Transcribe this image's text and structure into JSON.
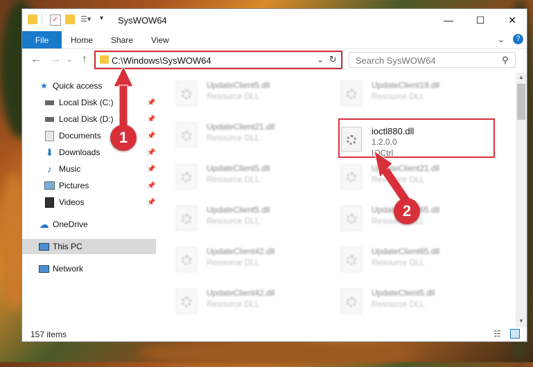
{
  "window": {
    "title": "SysWOW64"
  },
  "ribbon": {
    "tabs": [
      "File",
      "Home",
      "Share",
      "View"
    ]
  },
  "address": {
    "path": "C:\\Windows\\SysWOW64"
  },
  "search": {
    "placeholder": "Search SysWOW64"
  },
  "sidebar": {
    "items": [
      {
        "label": "Quick access",
        "icon": "star-icon"
      },
      {
        "label": "Local Disk (C:)",
        "icon": "drive-icon"
      },
      {
        "label": "Local Disk (D:)",
        "icon": "drive-icon"
      },
      {
        "label": "Documents",
        "icon": "documents-icon"
      },
      {
        "label": "Downloads",
        "icon": "download-icon"
      },
      {
        "label": "Music",
        "icon": "music-icon"
      },
      {
        "label": "Pictures",
        "icon": "pictures-icon"
      },
      {
        "label": "Videos",
        "icon": "videos-icon"
      },
      {
        "label": "OneDrive",
        "icon": "cloud-icon"
      },
      {
        "label": "This PC",
        "icon": "computer-icon"
      },
      {
        "label": "Network",
        "icon": "network-icon"
      }
    ]
  },
  "files": {
    "left": [
      {
        "name": "UpdateClient5.dll",
        "type": "Resource DLL"
      },
      {
        "name": "UpdateClient21.dll",
        "type": "Resource DLL"
      },
      {
        "name": "UpdateClient5.dll",
        "type": "Resource DLL"
      },
      {
        "name": "UpdateClient5.dll",
        "type": "Resource DLL"
      },
      {
        "name": "UpdateClient42.dll",
        "type": "Resource DLL"
      },
      {
        "name": "UpdateClient42.dll",
        "type": "Resource DLL"
      }
    ],
    "right": [
      {
        "name": "UpdateClient19.dll",
        "type": "Resource DLL"
      },
      {
        "name": "UpdateClient21.dll",
        "type": "Resource DLL"
      },
      {
        "name": "UpdateClient65.dll",
        "type": "Resource DLL"
      },
      {
        "name": "UpdateClient65.dll",
        "type": "Resource DLL"
      },
      {
        "name": "UpdateClient5.dll",
        "type": "Resource DLL"
      }
    ],
    "highlighted": {
      "name": "ioctl880.dll",
      "version": "1.2.0.0",
      "description": "IOCtrl"
    }
  },
  "status": {
    "count": "157 items"
  },
  "callouts": {
    "one": "1",
    "two": "2"
  },
  "colors": {
    "accent": "#1979ca",
    "highlight": "#d8303a"
  }
}
